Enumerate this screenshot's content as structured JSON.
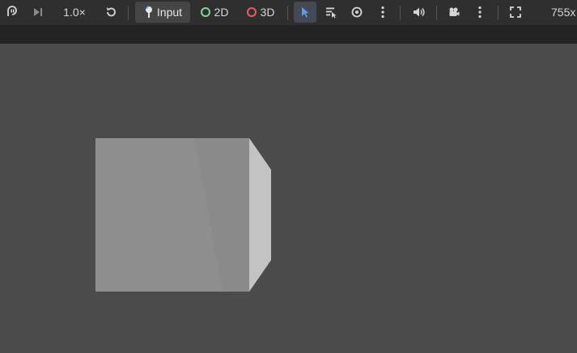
{
  "toolbar": {
    "speed_label": "1.0×",
    "input_label": "Input",
    "mode_2d_label": "2D",
    "mode_3d_label": "3D",
    "resolution_label": "755x",
    "colors": {
      "accent": "#5b9bf3",
      "ring_2d": "#7fd6a0",
      "ring_3d": "#e85d5d"
    }
  },
  "icons": {
    "play_pause": "pause-cycle-icon",
    "step": "step-forward-icon",
    "reset": "reset-icon",
    "input": "input-joystick-icon",
    "select": "arrow-cursor-icon",
    "list_select": "list-select-icon",
    "eye": "eye-icon",
    "more_1": "more-vertical-icon",
    "audio": "speaker-icon",
    "camera": "camera-icon",
    "more_2": "more-vertical-icon",
    "fullscreen": "fullscreen-icon"
  }
}
